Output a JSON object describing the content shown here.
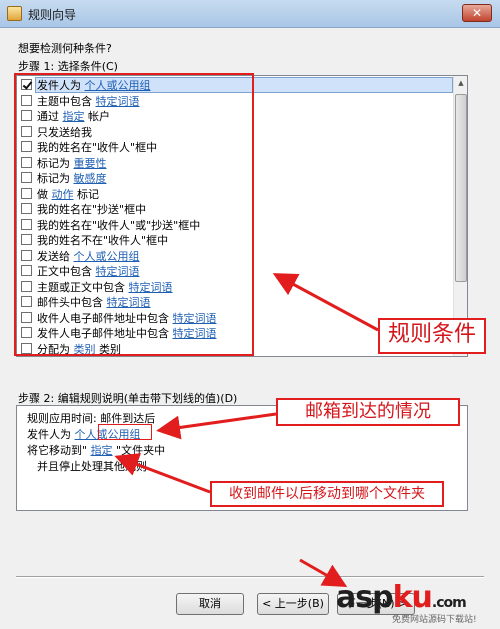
{
  "window": {
    "title": "规则向导",
    "close_glyph": "✕"
  },
  "question": "想要检测何种条件?",
  "step1_label": "步骤 1: 选择条件(C)",
  "conditions": [
    {
      "prefix": "发件人为 ",
      "link": "个人或公用组",
      "suffix": "",
      "checked": true
    },
    {
      "prefix": "主题中包含 ",
      "link": "特定词语",
      "suffix": "",
      "checked": false
    },
    {
      "prefix": "通过 ",
      "link": "指定",
      "suffix": " 帐户",
      "checked": false
    },
    {
      "prefix": "只发送给我",
      "link": "",
      "suffix": "",
      "checked": false
    },
    {
      "prefix": "我的姓名在\"收件人\"框中",
      "link": "",
      "suffix": "",
      "checked": false
    },
    {
      "prefix": "标记为 ",
      "link": "重要性",
      "suffix": "",
      "checked": false
    },
    {
      "prefix": "标记为 ",
      "link": "敏感度",
      "suffix": "",
      "checked": false
    },
    {
      "prefix": "做 ",
      "link": "动作",
      "suffix": " 标记",
      "checked": false
    },
    {
      "prefix": "我的姓名在\"抄送\"框中",
      "link": "",
      "suffix": "",
      "checked": false
    },
    {
      "prefix": "我的姓名在\"收件人\"或\"抄送\"框中",
      "link": "",
      "suffix": "",
      "checked": false
    },
    {
      "prefix": "我的姓名不在\"收件人\"框中",
      "link": "",
      "suffix": "",
      "checked": false
    },
    {
      "prefix": "发送给 ",
      "link": "个人或公用组",
      "suffix": "",
      "checked": false
    },
    {
      "prefix": "正文中包含 ",
      "link": "特定词语",
      "suffix": "",
      "checked": false
    },
    {
      "prefix": "主题或正文中包含 ",
      "link": "特定词语",
      "suffix": "",
      "checked": false
    },
    {
      "prefix": "邮件头中包含 ",
      "link": "特定词语",
      "suffix": "",
      "checked": false
    },
    {
      "prefix": "收件人电子邮件地址中包含 ",
      "link": "特定词语",
      "suffix": "",
      "checked": false
    },
    {
      "prefix": "发件人电子邮件地址中包含 ",
      "link": "特定词语",
      "suffix": "",
      "checked": false
    },
    {
      "prefix": "分配为 ",
      "link": "类别",
      "suffix": " 类别",
      "checked": false
    }
  ],
  "step2_label": "步骤 2: 编辑规则说明(单击带下划线的值)(D)",
  "description": {
    "line1": "规则应用时间: 邮件到达后",
    "line2_prefix": "发件人为 ",
    "line2_link": "个人或公用组",
    "line3_prefix": "将它移动到\" ",
    "line3_link": "指定",
    "line3_suffix": " \"文件夹中",
    "line4": "并且停止处理其他规则"
  },
  "buttons": {
    "cancel": "取消",
    "back": "< 上一步(B)",
    "next": "下一步(N) >"
  },
  "annotations": {
    "conditions": "规则条件",
    "arrival": "邮箱到达的情况",
    "move": "收到邮件以后移动到哪个文件夹"
  },
  "watermark": {
    "main_a": "asp",
    "main_b": "ku",
    "tld": ".com",
    "sub": "免费网站源码下载站!"
  },
  "colors": {
    "link": "#1f5fb3",
    "annotation": "#e21d1d",
    "titlebar": "#b5d0ec"
  }
}
